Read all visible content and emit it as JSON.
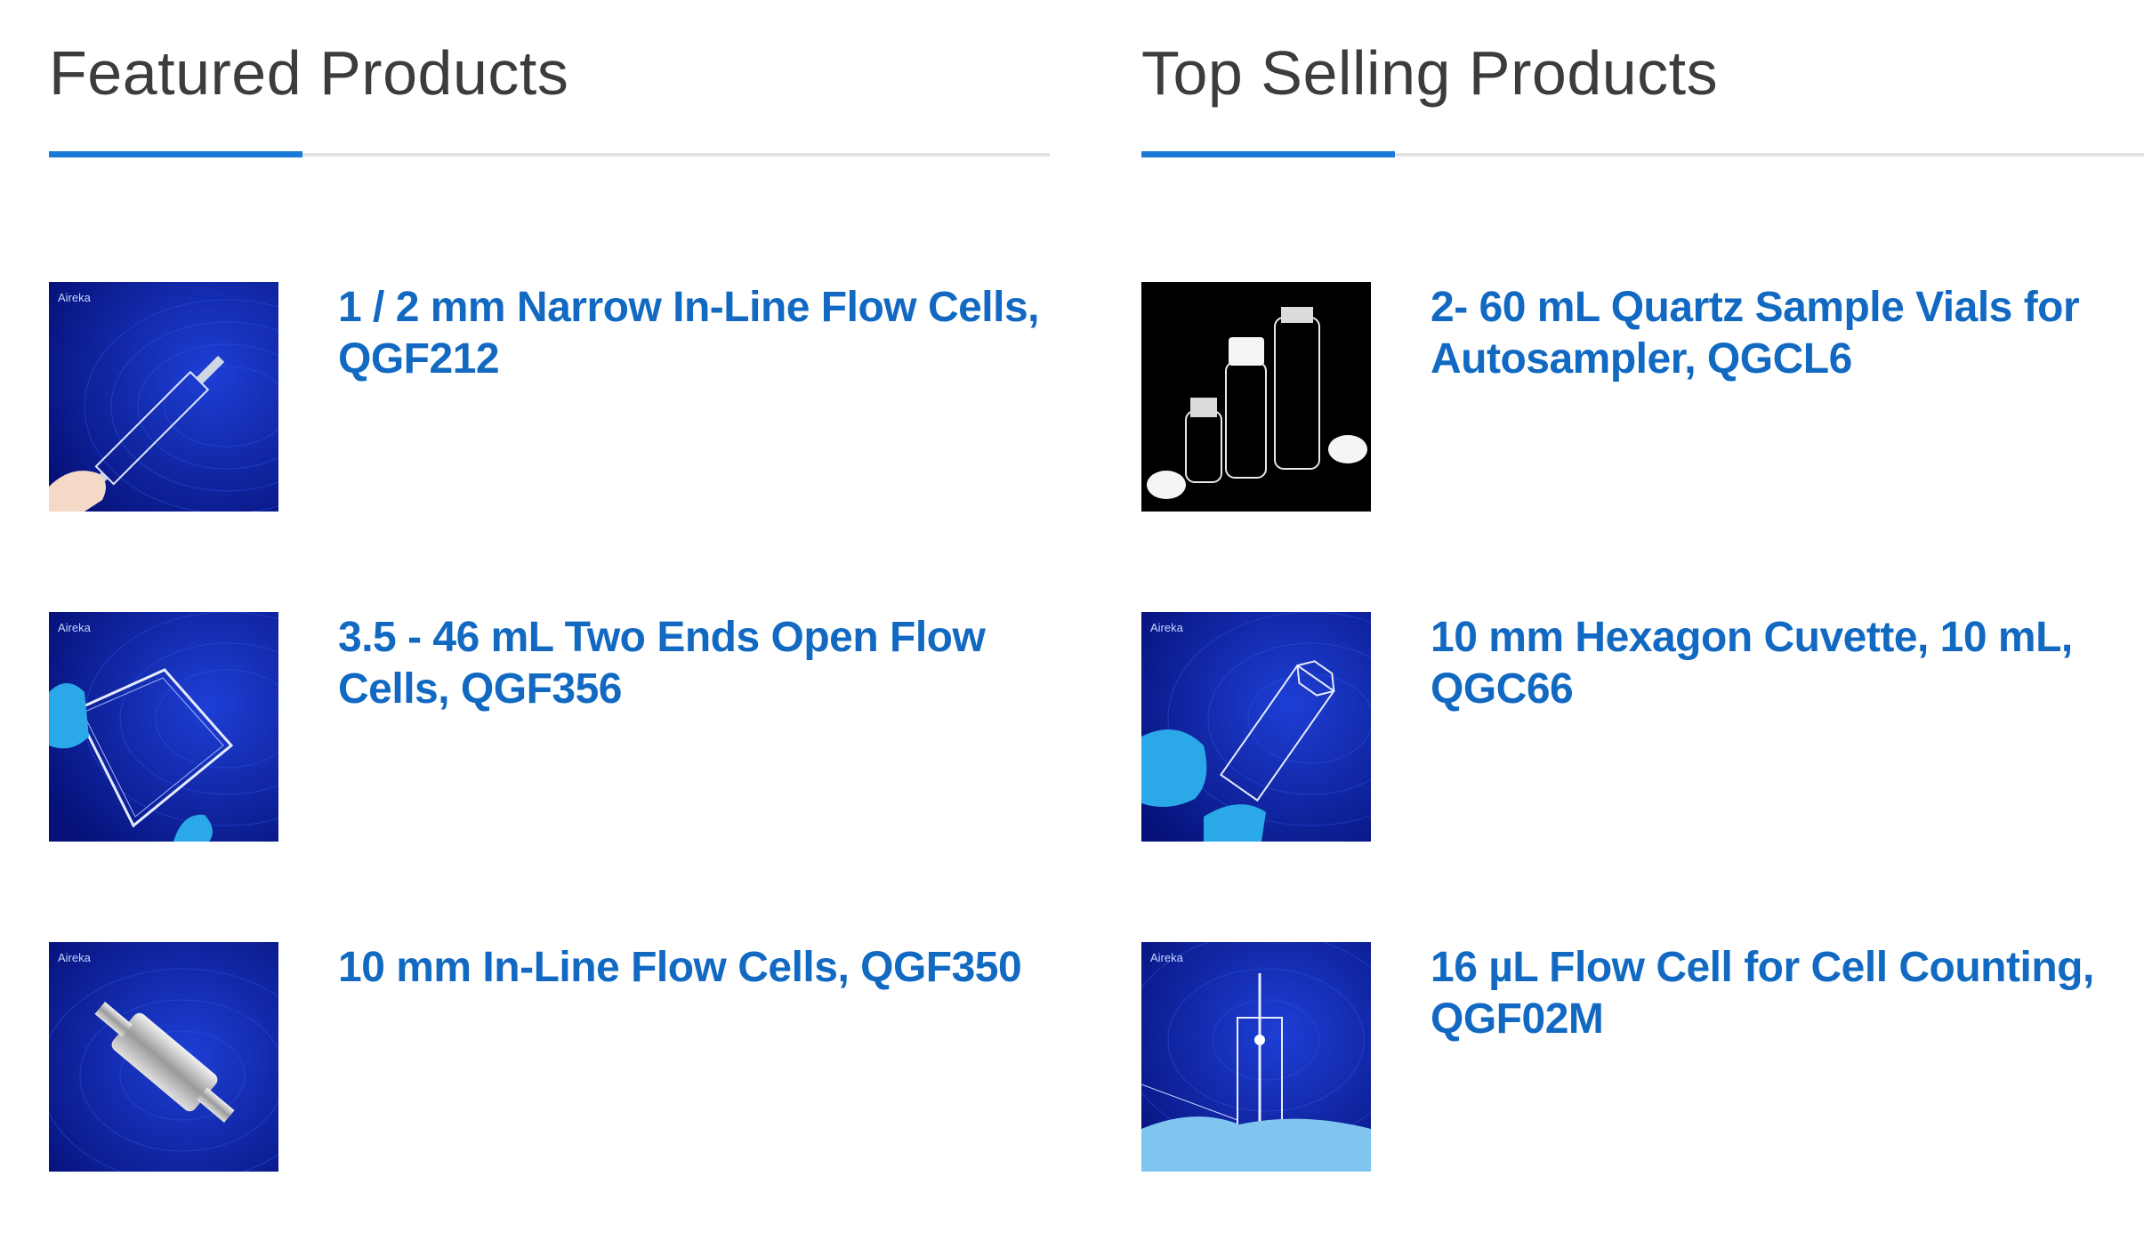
{
  "featured": {
    "title": "Featured Products",
    "products": [
      {
        "name": "1 / 2 mm Narrow In-Line Flow Cells, QGF212",
        "image_icon": "narrow-flow-cell-image"
      },
      {
        "name": "3.5 - 46 mL Two Ends Open Flow Cells, QGF356",
        "image_icon": "open-flow-cell-image"
      },
      {
        "name": "10 mm In-Line Flow Cells, QGF350",
        "image_icon": "inline-flow-cell-image"
      }
    ]
  },
  "top_selling": {
    "title": "Top Selling Products",
    "products": [
      {
        "name": "2- 60 mL Quartz Sample Vials for Autosampler, QGCL6",
        "image_icon": "sample-vials-image"
      },
      {
        "name": "10 mm Hexagon Cuvette, 10 mL, QGC66",
        "image_icon": "hexagon-cuvette-image"
      },
      {
        "name": "16 µL Flow Cell for Cell Counting, QGF02M",
        "image_icon": "cell-counting-flow-cell-image"
      }
    ]
  },
  "image_brand": "Aireka",
  "colors": {
    "accent": "#1a7ad6",
    "link": "#1269c2",
    "title": "#3c3c3c",
    "divider": "#e3e3e3",
    "thumb_bg": "#0a1f8a"
  }
}
